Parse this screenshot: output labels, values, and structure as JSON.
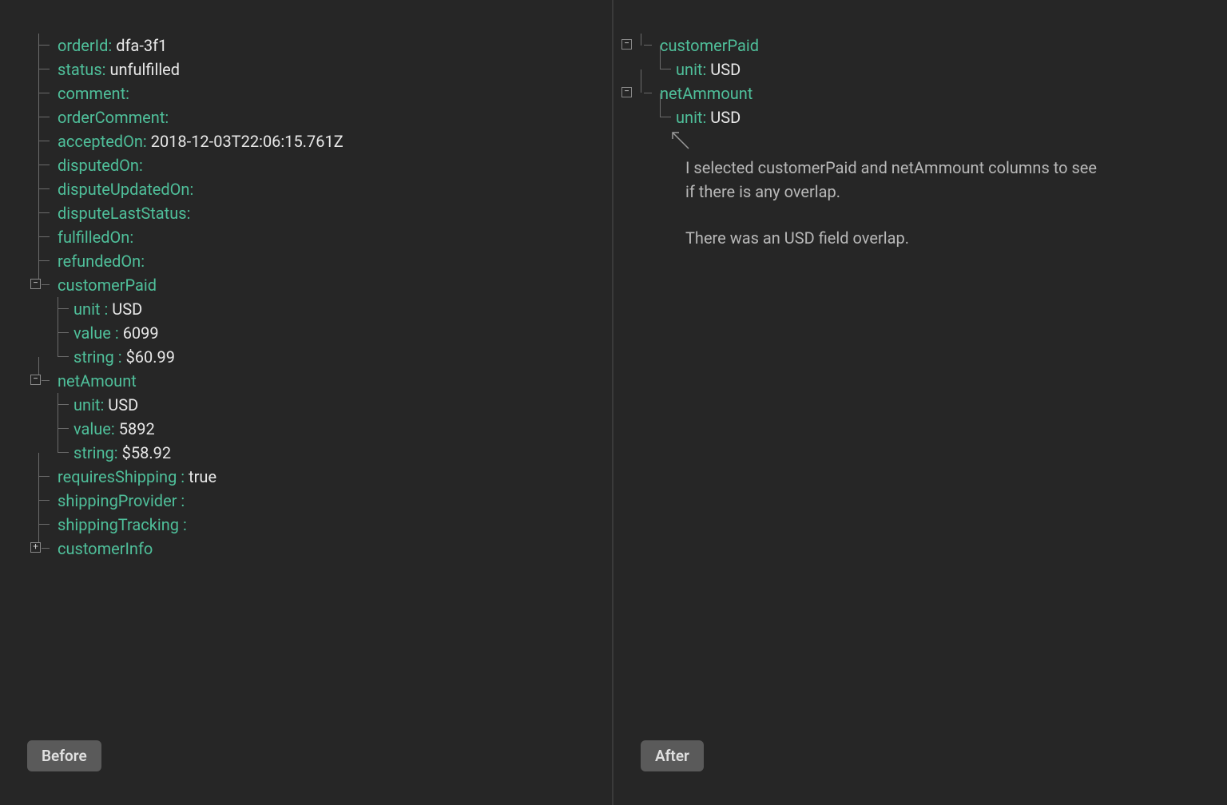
{
  "colors": {
    "key": "#4fbf9a",
    "value": "#e8e8e8",
    "bg": "#262626"
  },
  "left": {
    "badge": "Before",
    "fields": {
      "orderId": {
        "label": "orderId:",
        "value": "dfa-3f1"
      },
      "status": {
        "label": "status:",
        "value": "unfulfilled"
      },
      "comment": {
        "label": "comment:",
        "value": ""
      },
      "orderComment": {
        "label": "orderComment:",
        "value": ""
      },
      "acceptedOn": {
        "label": "acceptedOn:",
        "value": "2018-12-03T22:06:15.761Z"
      },
      "disputedOn": {
        "label": "disputedOn:",
        "value": ""
      },
      "disputeUpdatedOn": {
        "label": "disputeUpdatedOn:",
        "value": ""
      },
      "disputeLastStatus": {
        "label": "disputeLastStatus:",
        "value": ""
      },
      "fulfilledOn": {
        "label": "fulfilledOn:",
        "value": ""
      },
      "refundedOn": {
        "label": "refundedOn:",
        "value": ""
      },
      "customerPaid": {
        "label": "customerPaid",
        "unit": {
          "label": "unit :",
          "value": "USD"
        },
        "valueN": {
          "label": "value :",
          "value": "6099"
        },
        "string": {
          "label": "string :",
          "value": "$60.99"
        }
      },
      "netAmount": {
        "label": "netAmount",
        "unit": {
          "label": "unit:",
          "value": "USD"
        },
        "valueN": {
          "label": "value:",
          "value": "5892"
        },
        "string": {
          "label": "string:",
          "value": "$58.92"
        }
      },
      "requiresShipping": {
        "label": "requiresShipping :",
        "value": "true"
      },
      "shippingProvider": {
        "label": "shippingProvider :",
        "value": ""
      },
      "shippingTracking": {
        "label": "shippingTracking :",
        "value": ""
      },
      "customerInfo": {
        "label": "customerInfo"
      }
    }
  },
  "right": {
    "badge": "After",
    "fields": {
      "customerPaid": {
        "label": "customerPaid",
        "unit": {
          "label": "unit:",
          "value": "USD"
        }
      },
      "netAmmount": {
        "label": "netAmmount",
        "unit": {
          "label": "unit:",
          "value": "USD"
        }
      }
    },
    "annotation": {
      "p1": "I selected customerPaid and netAmmount columns to see if there is any overlap.",
      "p2": "There was an USD field overlap."
    }
  }
}
